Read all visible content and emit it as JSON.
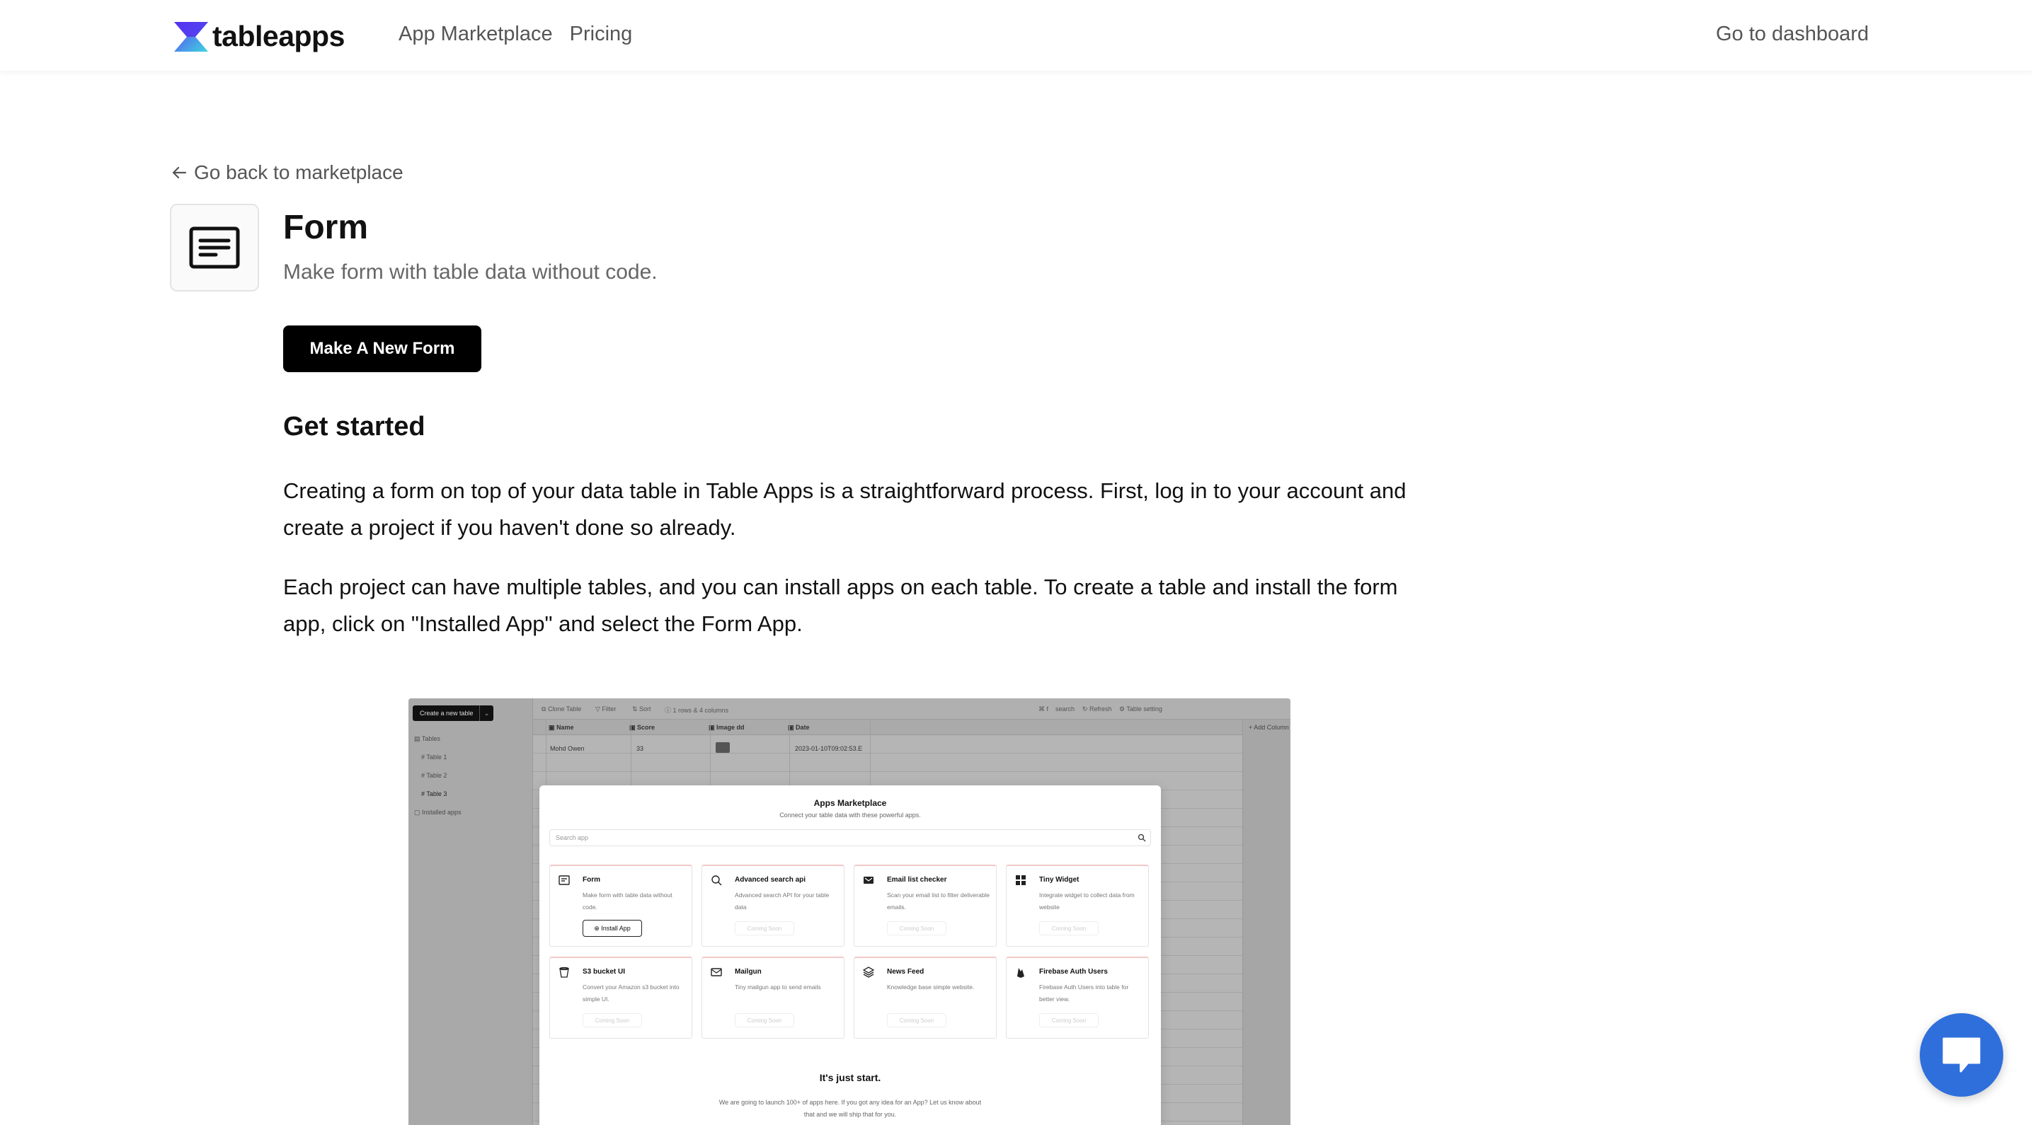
{
  "header": {
    "logo_text": "tableapps",
    "nav": [
      "App Marketplace",
      "Pricing"
    ],
    "dashboard_link": "Go to dashboard"
  },
  "back_link": "Go back to marketplace",
  "app": {
    "title": "Form",
    "subtitle": "Make form with table data without code.",
    "cta": "Make A New Form"
  },
  "get_started": {
    "heading": "Get started",
    "paragraphs": [
      "Creating a form on top of your data table in Table Apps is a straightforward process. First, log in to your account and create a project if you haven't done so already.",
      "Each project can have multiple tables, and you can install apps on each table. To create a table and install the form app, click on \"Installed App\" and select the Form App."
    ]
  },
  "screenshot": {
    "sidebar": {
      "create_button": "Create a new table",
      "tables_label": "Tables",
      "tables": [
        "Table 1",
        "Table 2",
        "Table 3"
      ],
      "installed_apps": "Installed apps"
    },
    "toolbar": {
      "clone": "Clone Table",
      "filter": "Filter",
      "sort": "Sort",
      "info": "1 rows & 4 columns",
      "shortcut": "⌘ f",
      "search": "search",
      "refresh": "Refresh",
      "settings": "Table setting"
    },
    "columns": [
      "Name",
      "Score",
      "Image dd",
      "Date"
    ],
    "add_column": "+ Add Column",
    "row": {
      "name": "Mohd Owen",
      "score": "33",
      "date": "2023-01-10T09:02:53.E"
    },
    "modal": {
      "title": "Apps Marketplace",
      "subtitle": "Connect your table data with these powerful apps.",
      "search_placeholder": "Search app",
      "cards": [
        {
          "title": "Form",
          "desc": "Make form with table data without code.",
          "action": "Install App",
          "icon": "form-icon"
        },
        {
          "title": "Advanced search api",
          "desc": "Advanced search API for your table data",
          "action": "Coming Soon",
          "icon": "search-icon"
        },
        {
          "title": "Email list checker",
          "desc": "Scan your email list to filter deliverable emails.",
          "action": "Coming Soon",
          "icon": "mail-check-icon"
        },
        {
          "title": "Tiny Widget",
          "desc": "Integrate widget to collect data from website",
          "action": "Coming Soon",
          "icon": "widget-icon"
        },
        {
          "title": "S3 bucket UI",
          "desc": "Convert your Amazon s3 bucket into simple UI.",
          "action": "Coming Soon",
          "icon": "bucket-icon"
        },
        {
          "title": "Mailgun",
          "desc": "Tiny mailgun app to send emails",
          "action": "Coming Soon",
          "icon": "mail-icon"
        },
        {
          "title": "News Feed",
          "desc": "Knowledge base simple website.",
          "action": "Coming Soon",
          "icon": "layers-icon"
        },
        {
          "title": "Firebase Auth Users",
          "desc": "Firebase Auth Users into table for better view.",
          "action": "Coming Soon",
          "icon": "firebase-icon"
        }
      ],
      "footer_title": "It's just start.",
      "footer_text": "We are going to launch 100+ of apps here. If you got any idea for an App? Let us know about that and we will ship that for you."
    }
  },
  "colors": {
    "accent_chat": "#2f6fdb",
    "button_bg": "#000000",
    "logo_gradient": [
      "#5b3df5",
      "#3fd6e0"
    ]
  }
}
